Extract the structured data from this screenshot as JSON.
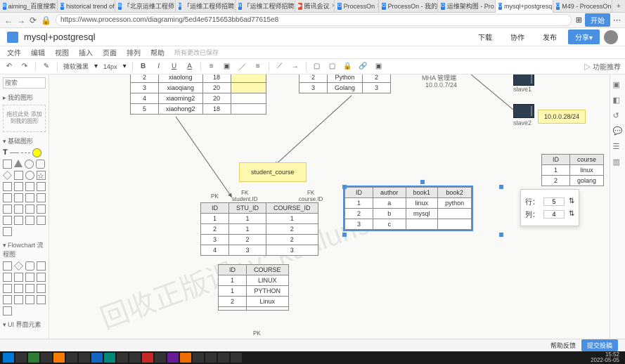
{
  "tabs": [
    {
      "label": "aiming_百度搜索",
      "ico": "B"
    },
    {
      "label": "historical trend of",
      "ico": "O"
    },
    {
      "label": "「北京运维工程师",
      "ico": "B"
    },
    {
      "label": "「运维工程师招聘",
      "ico": "B"
    },
    {
      "label": "「运维工程师招聘",
      "ico": "B"
    },
    {
      "label": "腾讯会议",
      "ico": "▶"
    },
    {
      "label": "ProcessOn",
      "ico": "O"
    },
    {
      "label": "ProcessOn - 我的",
      "ico": "O"
    },
    {
      "label": "运维架构图 - Pro",
      "ico": "O"
    },
    {
      "label": "mysql+postgresq",
      "ico": "O",
      "active": true
    },
    {
      "label": "M49 - ProcessOn",
      "ico": "O"
    }
  ],
  "url": "https://www.processon.com/diagraming/5ed4e6715653bb6ad77615e8",
  "urlbtn": "开始",
  "app": {
    "title": "mysql+postgresql",
    "buttons": {
      "download": "下载",
      "coop": "协作",
      "publish": "发布",
      "share": "分享▾"
    }
  },
  "menu": [
    "文件",
    "编辑",
    "视图",
    "插入",
    "页面",
    "排列",
    "帮助"
  ],
  "menuSaved": "所有更改已保存",
  "toolbar": {
    "font": "微软雅黑",
    "size": "14px",
    "feature": "▷ 功能推荐"
  },
  "sidebar": {
    "searchPlaceholder": "搜索",
    "myShapes": "▸ 我的图形",
    "dropHint": "拖拉此处\n添加到我的图形",
    "basic": "▾ 基础图形",
    "flowchart": "▾ Flowchart 流程图",
    "ui": "▾ UI 界面元素"
  },
  "canvas": {
    "watermark1": "回收正版课+v: kunlun991",
    "studentTable": {
      "rows": [
        [
          "2",
          "xiaolong",
          "18"
        ],
        [
          "3",
          "xiaoqiang",
          "20"
        ],
        [
          "4",
          "xiaoming2",
          "20"
        ],
        [
          "5",
          "xiaohong2",
          "18"
        ]
      ]
    },
    "langTable": {
      "rows": [
        [
          "2",
          "Python",
          "2"
        ],
        [
          "3",
          "Golang",
          "3"
        ]
      ]
    },
    "mha": "MHA 管理端",
    "ip1": "10.0.0.7/24",
    "slave1": "slave1",
    "slave2": "slave2",
    "ip2": "10.0.0.28/24",
    "noteStudentCourse": "student_course",
    "pk": "PK",
    "fk1": {
      "l1": "FK",
      "l2": "student.ID"
    },
    "fk2": {
      "l1": "FK",
      "l2": "course.ID"
    },
    "scTable": {
      "head": [
        "ID",
        "STU_ID",
        "COURSE_ID"
      ],
      "rows": [
        [
          "1",
          "1",
          "1"
        ],
        [
          "2",
          "1",
          "2"
        ],
        [
          "3",
          "2",
          "2"
        ],
        [
          "4",
          "3",
          "3"
        ]
      ]
    },
    "bookTable": {
      "head": [
        "ID",
        "author",
        "book1",
        "book2"
      ],
      "rows": [
        [
          "1",
          "a",
          "linux",
          "python"
        ],
        [
          "2",
          "b",
          "mysql",
          ""
        ],
        [
          "3",
          "c",
          "",
          ""
        ]
      ]
    },
    "courseListTable": {
      "head": [
        "ID",
        "course"
      ],
      "rows": [
        [
          "1",
          "linux"
        ],
        [
          "2",
          "golang"
        ]
      ]
    },
    "courseTable": {
      "head": [
        "ID",
        "COURSE"
      ],
      "rows": [
        [
          "1",
          "LINUX"
        ],
        [
          "1",
          "PYTHON"
        ],
        [
          "2",
          "Linux"
        ],
        [
          "",
          ""
        ]
      ]
    },
    "pkBottom": "PK",
    "popup": {
      "rowLabel": "行：",
      "colLabel": "列：",
      "rowVal": "5",
      "colVal": "4"
    }
  },
  "bottom": {
    "help": "帮助反馈",
    "submit": "提交投稿"
  },
  "clock": {
    "time": "15:52",
    "date": "2022-05-05"
  }
}
